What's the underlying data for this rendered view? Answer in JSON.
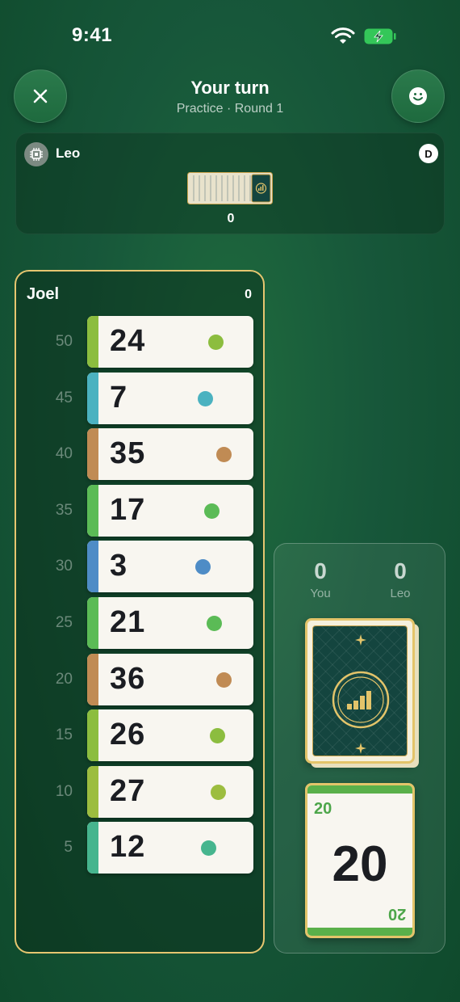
{
  "status": {
    "time": "9:41"
  },
  "header": {
    "title": "Your turn",
    "subtitle": "Practice · Round 1"
  },
  "opponent": {
    "name": "Leo",
    "dealer_badge": "D",
    "hand_count": "0"
  },
  "player": {
    "name": "Joel",
    "score": "0",
    "rows": [
      {
        "label": "50",
        "card": "24",
        "color": "#8cbd3f"
      },
      {
        "label": "45",
        "card": "7",
        "color": "#4bb2c0"
      },
      {
        "label": "40",
        "card": "35",
        "color": "#c08b54"
      },
      {
        "label": "35",
        "card": "17",
        "color": "#5bbb56"
      },
      {
        "label": "30",
        "card": "3",
        "color": "#4e8cc6"
      },
      {
        "label": "25",
        "card": "21",
        "color": "#5bbb56"
      },
      {
        "label": "20",
        "card": "36",
        "color": "#c08b54"
      },
      {
        "label": "15",
        "card": "26",
        "color": "#8cbd3f"
      },
      {
        "label": "10",
        "card": "27",
        "color": "#9cbd3f"
      },
      {
        "label": "5",
        "card": "12",
        "color": "#46b58e"
      }
    ]
  },
  "scoreboard": {
    "you": {
      "value": "0",
      "label": "You"
    },
    "opponent": {
      "value": "0",
      "label": "Leo"
    }
  },
  "discard": {
    "value": "20",
    "color": "#5ab04a"
  },
  "colors": {
    "accent_gold": "#e6c670",
    "felt": "#17573a"
  }
}
